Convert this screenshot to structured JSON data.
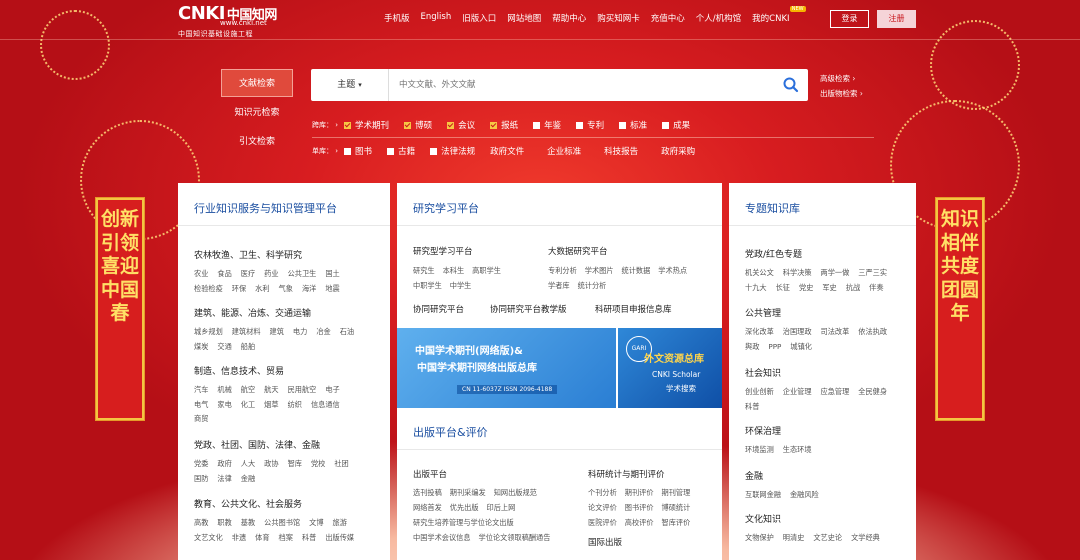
{
  "header": {
    "logo_text": "CNKI",
    "logo_cn": "中国知网",
    "logo_url": "www.cnki.net",
    "logo_sub": "中国知识基础设施工程",
    "nav": [
      "手机版",
      "English",
      "旧版入口",
      "网站地图",
      "帮助中心",
      "购买知网卡",
      "充值中心",
      "个人/机构馆",
      "我的CNKI"
    ],
    "nav_badge": "NEW",
    "login": "登录",
    "register": "注册"
  },
  "search": {
    "tabs": [
      "文献检索",
      "知识元检索",
      "引文检索"
    ],
    "field_select": "主题",
    "placeholder": "中文文献、外文文献",
    "advanced": "高级检索",
    "publication": "出版物检索",
    "cross_label": "跨库：",
    "cross_items": [
      {
        "label": "学术期刊",
        "checked": true
      },
      {
        "label": "博硕",
        "checked": true
      },
      {
        "label": "会议",
        "checked": true
      },
      {
        "label": "报纸",
        "checked": true
      },
      {
        "label": "年鉴",
        "checked": false
      },
      {
        "label": "专利",
        "checked": false
      },
      {
        "label": "标准",
        "checked": false
      },
      {
        "label": "成果",
        "checked": false
      }
    ],
    "single_label": "单库：",
    "single_checks": [
      "图书",
      "古籍",
      "法律法规"
    ],
    "single_plain": [
      "政府文件",
      "企业标准",
      "科技报告",
      "政府采购"
    ]
  },
  "banners": {
    "left": "创新引领喜迎中国春",
    "right": "知识相伴共度团圆年"
  },
  "card_industry": {
    "title": "行业知识服务与知识管理平台",
    "groups": [
      {
        "title": "农林牧渔、卫生、科学研究",
        "lines": [
          [
            "农业",
            "食品",
            "医疗",
            "药业",
            "公共卫生",
            "国土"
          ],
          [
            "检验检疫",
            "环保",
            "水利",
            "气象",
            "海洋",
            "地震"
          ]
        ]
      },
      {
        "title": "建筑、能源、冶炼、交通运输",
        "lines": [
          [
            "城乡规划",
            "建筑材料",
            "建筑",
            "电力",
            "冶金",
            "石油"
          ],
          [
            "煤炭",
            "交通",
            "船舶"
          ]
        ]
      },
      {
        "title": "制造、信息技术、贸易",
        "lines": [
          [
            "汽车",
            "机械",
            "航空",
            "航天",
            "民用航空",
            "电子"
          ],
          [
            "电气",
            "家电",
            "化工",
            "烟草",
            "纺织",
            "信息通信"
          ],
          [
            "商贸"
          ]
        ]
      },
      {
        "title": "党政、社团、国防、法律、金融",
        "lines": [
          [
            "党委",
            "政府",
            "人大",
            "政协",
            "智库",
            "党校",
            "社团"
          ],
          [
            "国防",
            "法律",
            "金融"
          ]
        ]
      },
      {
        "title": "教育、公共文化、社会服务",
        "lines": [
          [
            "高教",
            "职教",
            "基教",
            "公共图书馆",
            "文博",
            "旅游"
          ],
          [
            "文艺文化",
            "非遗",
            "体育",
            "档案",
            "科普",
            "出版传媒"
          ]
        ]
      }
    ]
  },
  "card_research": {
    "title": "研究学习平台",
    "col1_title": "研究型学习平台",
    "col1_items": [
      [
        "研究生",
        "本科生",
        "高职学生"
      ],
      [
        "中职学生",
        "中学生"
      ]
    ],
    "col2_title": "大数据研究平台",
    "col2_items": [
      [
        "专利分析",
        "学术图片",
        "统计数据",
        "学术热点"
      ],
      [
        "学者库",
        "统计分析"
      ]
    ],
    "links": [
      "协同研究平台",
      "协同研究平台教学版",
      "科研项目申报信息库"
    ],
    "promo1_title": "中国学术期刊(网络版)&",
    "promo1_title2": "中国学术期刊网络出版总库",
    "promo1_sub": "CN 11-6037Z   ISSN 2096-4188",
    "promo2_tag": "GARI",
    "promo2_title": "外文资源总库",
    "promo2_sub1": "CNKI Scholar",
    "promo2_sub2": "学术搜索",
    "publish_title": "出版平台&评价",
    "pub_col1_title": "出版平台",
    "pub_col1_items": [
      [
        "选刊投稿",
        "期刊采编发",
        "知网出版规范"
      ],
      [
        "网络首发",
        "优先出版",
        "印后上网"
      ],
      [
        "研究生培养管理与学位论文出版"
      ],
      [
        "中国学术会议信息",
        "学位论文领取稿酬通告"
      ]
    ],
    "pub_col2_title": "科研统计与期刊评价",
    "pub_col2_items": [
      [
        "个刊分析",
        "期刊评价",
        "期刊管理"
      ],
      [
        "论文评价",
        "图书评价",
        "博硕统计"
      ],
      [
        "医院评价",
        "高校评价",
        "智库评价"
      ]
    ],
    "pub_col3_title": "国际出版"
  },
  "card_topic": {
    "title": "专题知识库",
    "groups": [
      {
        "title": "党政/红色专题",
        "lines": [
          [
            "机关公文",
            "科学决策",
            "两学一做",
            "三严三实"
          ],
          [
            "十九大",
            "长征",
            "党史",
            "军史",
            "抗战",
            "伴奏"
          ]
        ]
      },
      {
        "title": "公共管理",
        "lines": [
          [
            "深化改革",
            "治国理政",
            "司法改革",
            "依法执政"
          ],
          [
            "舆政",
            "PPP",
            "城镇化"
          ]
        ]
      },
      {
        "title": "社会知识",
        "lines": [
          [
            "创业创新",
            "企业管理",
            "应急管理",
            "全民健身"
          ],
          [
            "科普"
          ]
        ]
      },
      {
        "title": "环保治理",
        "lines": [
          [
            "环境监测",
            "生态环境"
          ]
        ]
      },
      {
        "title": "金融",
        "lines": [
          [
            "互联网金融",
            "金融风险"
          ]
        ]
      },
      {
        "title": "文化知识",
        "lines": [
          [
            "文物保护",
            "明清史",
            "文艺史论",
            "文学经典"
          ]
        ]
      }
    ]
  },
  "colors": {
    "bg_red": "#c8141b",
    "title_blue": "#1a4ea0",
    "banner_gold": "#ffe066"
  }
}
